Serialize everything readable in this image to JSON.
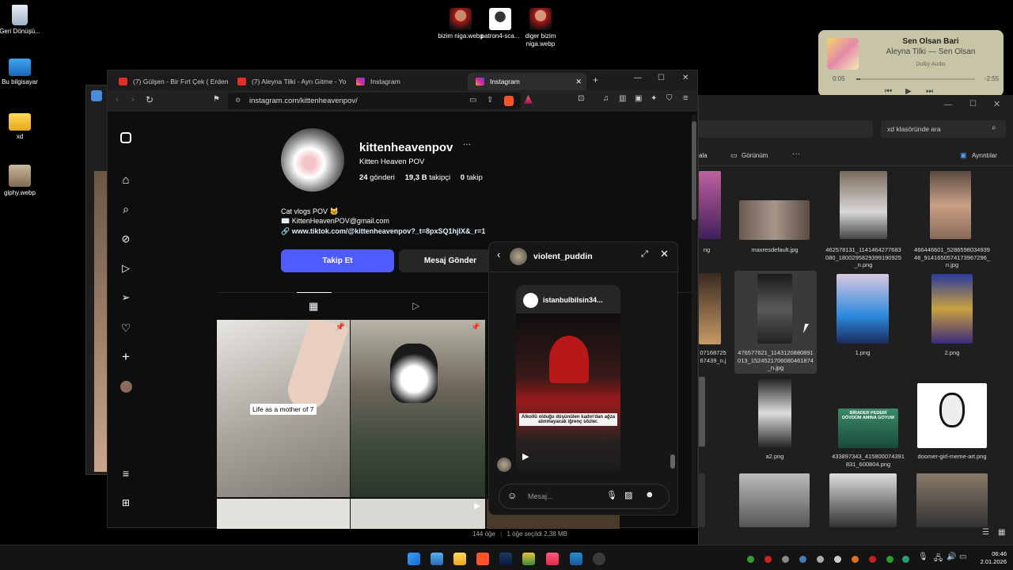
{
  "desktop": {
    "left_icons": [
      {
        "label": "Geri Dönüşü...",
        "icon": "recycle-bin-icon"
      },
      {
        "label": "Bu bilgisayar",
        "icon": "computer-icon"
      },
      {
        "label": "xd",
        "icon": "folder-icon"
      },
      {
        "label": "giphy.webp",
        "icon": "image-file-icon"
      }
    ],
    "top_icons": [
      {
        "label": "bizim niga.webp",
        "icon": "image-file-icon"
      },
      {
        "label": "patron4-sca...",
        "icon": "image-file-icon"
      },
      {
        "label": "diger bizim niga.webp",
        "icon": "image-file-icon"
      }
    ]
  },
  "music": {
    "title": "Sen Olsan Bari",
    "artist": "Aleyna Tilki — Sen Olsan",
    "format": "Dolby Audio",
    "elapsed": "0:05",
    "remaining": "-2:55",
    "progress": 0.03
  },
  "explorer": {
    "search_placeholder": "xd klasöründe ara",
    "toolbar": {
      "partial_label": "ala",
      "view_label": "Görünüm",
      "details_label": "Ayrıntılar"
    },
    "items": [
      {
        "caption": "ng"
      },
      {
        "caption": "maxresdefault.jpg"
      },
      {
        "caption": "462578131_1141464277683080_1800295829399190925_n.png"
      },
      {
        "caption": "466446601_528659803493946_9141650574173967296_n.jpg"
      },
      {
        "caption": "07168725 67439_n.j"
      },
      {
        "caption": "476577621_1143120880891013_1524521706080461874_n.jpg"
      },
      {
        "caption": "1.png"
      },
      {
        "caption": "2.png"
      },
      {
        "caption": "a2.png"
      },
      {
        "caption": "433897343_415800074391831_600804.png"
      },
      {
        "caption": "doomer-girl-meme-art.png"
      },
      {
        "caption": "BİRADER PEDERİ DÖVDÜM AMINA GOYUM"
      }
    ],
    "status": {
      "count": "144 öğe",
      "selected": "1 öğe seçildi  2,38 MB"
    }
  },
  "browser": {
    "tabs": [
      {
        "label": "(7) Gülşen - Bir Fırt Çek ( Erdem D",
        "icon": "youtube-icon"
      },
      {
        "label": "(7) Aleyna Tilki - Ayrı Gitme - You",
        "icon": "youtube-icon"
      },
      {
        "label": "Instagram",
        "icon": "instagram-icon"
      },
      {
        "label": "Instagram",
        "icon": "instagram-icon",
        "active": true
      }
    ],
    "url": "instagram.com/kittenheavenpov/"
  },
  "profile": {
    "username": "kittenheavenpov",
    "more": "···",
    "full_name": "Kitten Heaven POV",
    "posts_count": "24",
    "posts_label": "gönderi",
    "followers_count": "19,3 B",
    "followers_label": "takipçi",
    "following_count": "0",
    "following_label": "takip",
    "bio_line1": "Cat vlogs POV 🐱",
    "bio_line2": "✉️ KittenHeavenPOV@gmail.com",
    "link": "www.tiktok.com/@kittenheavenpov?_t=8pxSQ1hjIX&_r=1",
    "follow_label": "Takip Et",
    "message_label": "Mesaj Gönder",
    "post1_caption": "Life as a mother of 7"
  },
  "dm": {
    "username": "violent_puddin",
    "shared_account": "istanbulbilsin34...",
    "story_caption": "Alkollü olduğu düşünülen kadın'dan ağza alınmayacak iğrenç sözler.",
    "input_placeholder": "Mesaj..."
  },
  "taskbar": {
    "time": "06:46",
    "date": "2.01.2026"
  },
  "colors": {
    "accent": "#4f5bff",
    "link": "#e0f1ff",
    "taskbar": "#141414"
  }
}
